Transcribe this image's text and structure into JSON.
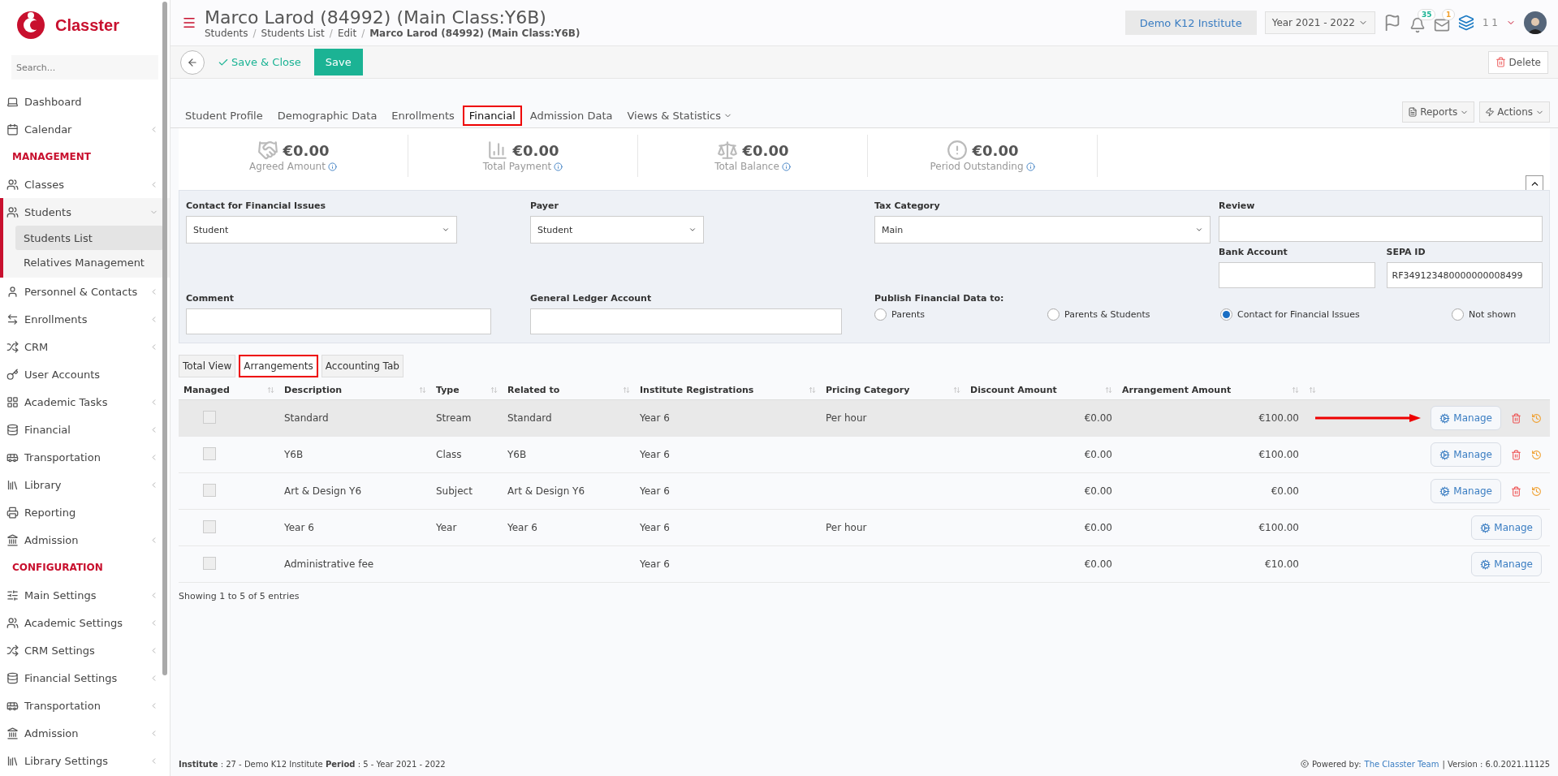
{
  "sidebar": {
    "brand": "Classter",
    "search": {
      "placeholder": "Search..."
    },
    "items": [
      {
        "kind": "item",
        "label": "Dashboard",
        "expandable": false
      },
      {
        "kind": "item",
        "label": "Calendar",
        "expandable": true
      },
      {
        "kind": "section",
        "label": "MANAGEMENT"
      },
      {
        "kind": "item",
        "label": "Classes",
        "expandable": true
      },
      {
        "kind": "item",
        "label": "Students",
        "expandable": true,
        "expanded": true,
        "children": [
          {
            "label": "Students List",
            "selected": true
          },
          {
            "label": "Relatives Management",
            "selected": false
          }
        ]
      },
      {
        "kind": "item",
        "label": "Personnel & Contacts",
        "expandable": true
      },
      {
        "kind": "item",
        "label": "Enrollments",
        "expandable": true
      },
      {
        "kind": "item",
        "label": "CRM",
        "expandable": true
      },
      {
        "kind": "item",
        "label": "User Accounts",
        "expandable": false
      },
      {
        "kind": "item",
        "label": "Academic Tasks",
        "expandable": true
      },
      {
        "kind": "item",
        "label": "Financial",
        "expandable": true
      },
      {
        "kind": "item",
        "label": "Transportation",
        "expandable": true
      },
      {
        "kind": "item",
        "label": "Library",
        "expandable": true
      },
      {
        "kind": "item",
        "label": "Reporting",
        "expandable": false
      },
      {
        "kind": "item",
        "label": "Admission",
        "expandable": true
      },
      {
        "kind": "section",
        "label": "CONFIGURATION"
      },
      {
        "kind": "item",
        "label": "Main Settings",
        "expandable": true
      },
      {
        "kind": "item",
        "label": "Academic Settings",
        "expandable": true
      },
      {
        "kind": "item",
        "label": "CRM Settings",
        "expandable": true
      },
      {
        "kind": "item",
        "label": "Financial Settings",
        "expandable": true
      },
      {
        "kind": "item",
        "label": "Transportation",
        "expandable": true
      },
      {
        "kind": "item",
        "label": "Admission",
        "expandable": true
      },
      {
        "kind": "item",
        "label": "Library Settings",
        "expandable": true
      }
    ]
  },
  "header": {
    "title": "Marco Larod (84992) (Main Class:Y6B)",
    "breadcrumbs": [
      "Students",
      "Students List",
      "Edit",
      "Marco Larod (84992) (Main Class:Y6B)"
    ],
    "breadcrumb_separator": "/",
    "institute": "Demo K12 Institute",
    "year": "Year 2021 - 2022",
    "notifications": "35",
    "messages": "1",
    "user": "1 1"
  },
  "toolbar": {
    "save_close": "Save & Close",
    "save": "Save",
    "delete": "Delete"
  },
  "tabs": [
    {
      "label": "Student Profile",
      "selected": false,
      "highlighted": false,
      "dropdown": false
    },
    {
      "label": "Demographic Data",
      "selected": false,
      "highlighted": false,
      "dropdown": false
    },
    {
      "label": "Enrollments",
      "selected": false,
      "highlighted": false,
      "dropdown": false
    },
    {
      "label": "Financial",
      "selected": true,
      "highlighted": true,
      "dropdown": false
    },
    {
      "label": "Admission Data",
      "selected": false,
      "highlighted": false,
      "dropdown": false
    },
    {
      "label": "Views & Statistics",
      "selected": false,
      "highlighted": false,
      "dropdown": true
    }
  ],
  "tab_actions": [
    "Reports",
    "Actions"
  ],
  "summary": [
    {
      "amount": "€0.00",
      "label": "Agreed Amount"
    },
    {
      "amount": "€0.00",
      "label": "Total Payment"
    },
    {
      "amount": "€0.00",
      "label": "Total Balance"
    },
    {
      "amount": "€0.00",
      "label": "Period Outstanding"
    }
  ],
  "form": {
    "contact": {
      "label": "Contact for Financial Issues",
      "value": "Student"
    },
    "payer": {
      "label": "Payer",
      "value": "Student"
    },
    "tax": {
      "label": "Tax Category",
      "value": "Main"
    },
    "review": {
      "label": "Review"
    },
    "bank": {
      "label": "Bank Account"
    },
    "sepa": {
      "label": "SEPA ID",
      "value": "RF349123480000000008499"
    },
    "comment": {
      "label": "Comment"
    },
    "ledger": {
      "label": "General Ledger Account"
    },
    "publish": {
      "label": "Publish Financial Data to:",
      "options": [
        {
          "label": "Parents",
          "selected": false
        },
        {
          "label": "Parents & Students",
          "selected": false
        },
        {
          "label": "Contact for Financial Issues",
          "selected": true
        },
        {
          "label": "Not shown",
          "selected": false
        }
      ]
    }
  },
  "subtabs": [
    {
      "label": "Total View",
      "selected": false,
      "highlighted": false
    },
    {
      "label": "Arrangements",
      "selected": true,
      "highlighted": true
    },
    {
      "label": "Accounting Tab",
      "selected": false,
      "highlighted": false
    }
  ],
  "table": {
    "columns": [
      "Managed",
      "Description",
      "Type",
      "Related to",
      "Institute Registrations",
      "Pricing Category",
      "Discount Amount",
      "Arrangement Amount"
    ],
    "rows": [
      {
        "checked": false,
        "selected": true,
        "pointed": true,
        "removable": true,
        "cells": [
          "",
          "Standard",
          "Stream",
          "Standard",
          "Year 6",
          "Per hour",
          "€0.00",
          "€100.00"
        ],
        "action": "Manage"
      },
      {
        "checked": false,
        "selected": false,
        "pointed": false,
        "removable": true,
        "cells": [
          "",
          "Y6B",
          "Class",
          "Y6B",
          "Year 6",
          "",
          "€0.00",
          "€100.00"
        ],
        "action": "Manage"
      },
      {
        "checked": false,
        "selected": false,
        "pointed": false,
        "removable": true,
        "cells": [
          "",
          "Art & Design Y6",
          "Subject",
          "Art & Design Y6",
          "Year 6",
          "",
          "€0.00",
          "€0.00"
        ],
        "action": "Manage"
      },
      {
        "checked": false,
        "selected": false,
        "pointed": false,
        "removable": false,
        "cells": [
          "",
          "Year 6",
          "Year",
          "Year 6",
          "Year 6",
          "Per hour",
          "€0.00",
          "€100.00"
        ],
        "action": "Manage"
      },
      {
        "checked": false,
        "selected": false,
        "pointed": false,
        "removable": false,
        "cells": [
          "",
          "Administrative fee",
          "",
          "",
          "Year 6",
          "",
          "€0.00",
          "€10.00"
        ],
        "action": "Manage"
      }
    ],
    "info": "Showing 1 to 5 of 5 entries"
  },
  "footer": {
    "context": "**Institute** : 27 - Demo K12 Institute **Period** : 5 - Year 2021 - 2022",
    "powered": "Powered by:",
    "team": "The Classter Team",
    "version": "| Version : 6.0.2021.11125"
  }
}
